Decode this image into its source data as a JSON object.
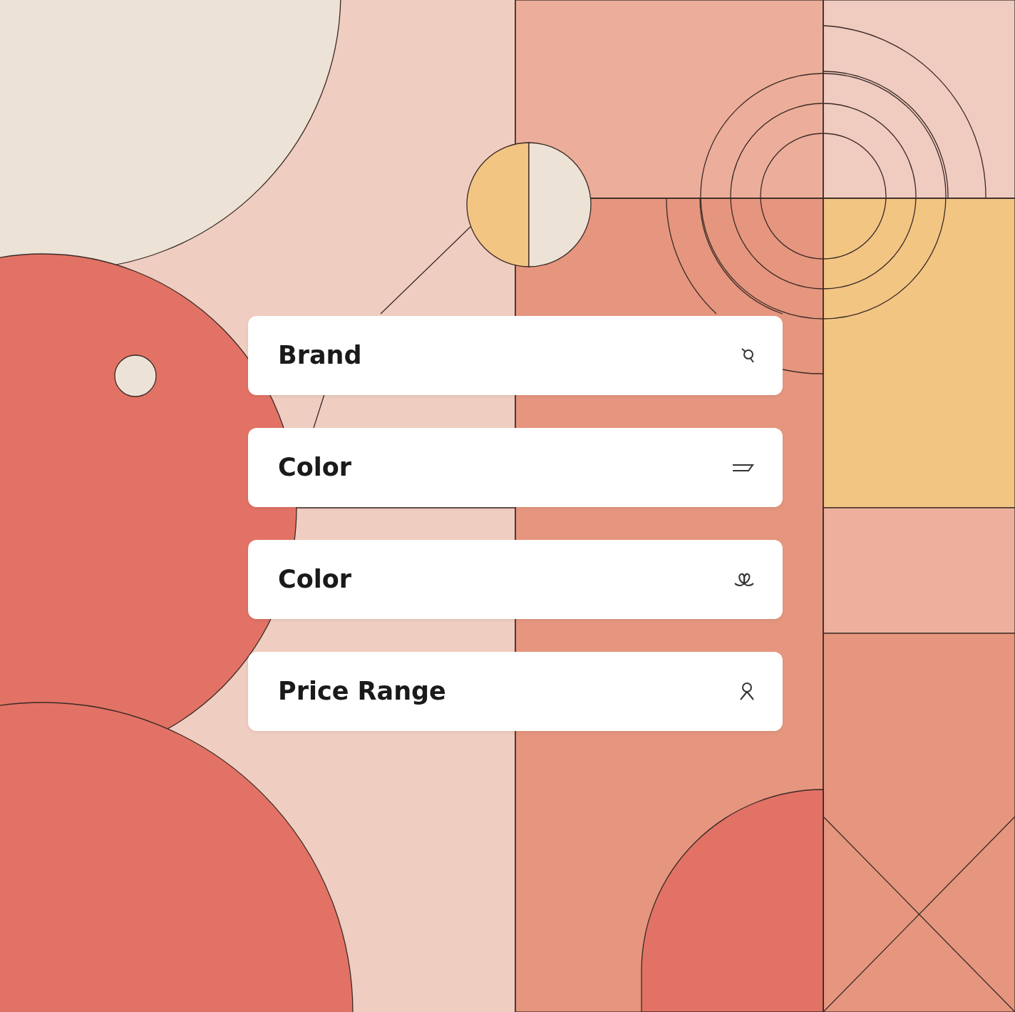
{
  "filters": [
    {
      "label": "Brand",
      "kind": "tag"
    },
    {
      "label": "Color",
      "kind": "lines"
    },
    {
      "label": "Color",
      "kind": "flower"
    },
    {
      "label": "Price Range",
      "kind": "person"
    }
  ]
}
